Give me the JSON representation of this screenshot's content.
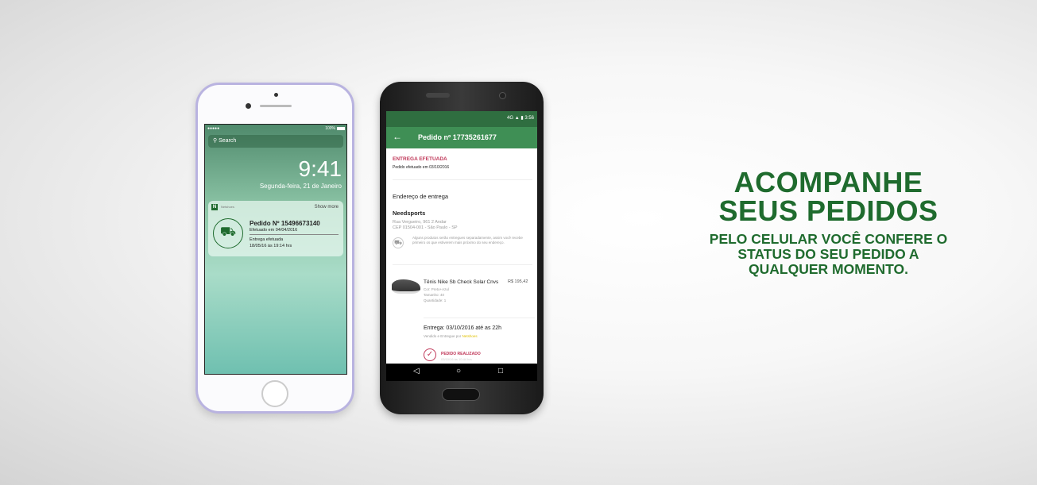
{
  "headline": {
    "line1": "ACOMPANHE",
    "line2": "SEUS PEDIDOS",
    "sub1": "PELO CELULAR VOCÊ CONFERE O",
    "sub2": "STATUS DO SEU PEDIDO A",
    "sub3": "QUALQUER MOMENTO."
  },
  "iphone": {
    "signal": "●●●●●",
    "battery": "100%",
    "search": "Search",
    "time": "9:41",
    "date": "Segunda-feira, 21 de Janeiro",
    "notif": {
      "app": "Netshoes",
      "show_more": "Show more",
      "title": "Pedido Nº 15496673140",
      "subtitle": "Efetuado em 04/04/2016",
      "status": "Entrega efetuada",
      "when": "18/05/16 às 19:14 hrs"
    }
  },
  "android": {
    "status_time": "3:56",
    "network": "4G",
    "title": "Pedido nº 17735261677",
    "delivery_status": "ENTREGA EFETUADA",
    "order_date": "Pedido efetuado em 03/10/2016",
    "address_heading": "Endereço de entrega",
    "address_name": "Needsports",
    "address_line1": "Rua Vergueiro, 961 2 Andar",
    "address_line2": "CEP 01504-001 - São Paulo - SP",
    "notice": "Alguns produtos serão entregues separadamente, assim você recebe primeiro os que estiverem mais próximo do seu endereço.",
    "product": {
      "name": "Tênis Nike Sb Check Solar Cnvs",
      "price": "R$ 195,42",
      "color": "Cor: Preto+Azul",
      "size": "Tamanho: 40",
      "qty": "Quantidade: 1"
    },
    "delivery": "Entrega: 03/10/2016 até as 22h",
    "seller_prefix": "Vendido e Entregue por",
    "seller": "Netshoes",
    "step": "PEDIDO REALIZADO",
    "step_date": "03/10/16 às 10:44 hrs"
  },
  "colors": {
    "brand_green": "#1f6b2e",
    "appbar": "#3f8f55",
    "alert": "#c0395a"
  }
}
